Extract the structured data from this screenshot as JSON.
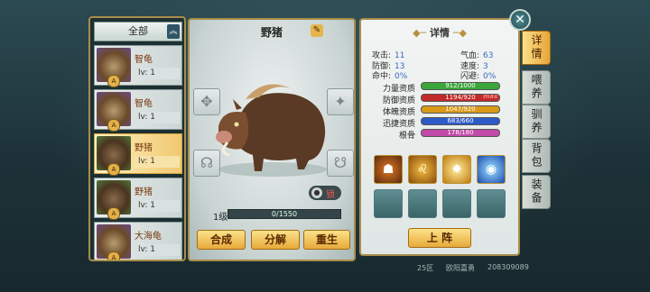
{
  "filter": {
    "label": "全部",
    "arrow": "︽"
  },
  "pets": [
    {
      "name": "智龟",
      "level": "lv: 1",
      "badge": "A",
      "selected": false
    },
    {
      "name": "智龟",
      "level": "lv: 1",
      "badge": "A",
      "selected": false
    },
    {
      "name": "野猪",
      "level": "lv: 1",
      "badge": "A",
      "selected": true
    },
    {
      "name": "野猪",
      "level": "lv: 1",
      "badge": "A",
      "selected": false
    },
    {
      "name": "大海龟",
      "level": "lv: 1",
      "badge": "A",
      "selected": false
    }
  ],
  "pet": {
    "name": "野猪",
    "edit_icon": "✎",
    "lock": {
      "icon": "锁",
      "label": "锁"
    },
    "level_label": "1级",
    "exp_text": "0/1550",
    "exp_fraction": 0.0
  },
  "actions": {
    "combine": "合成",
    "decompose": "分解",
    "reborn": "重生",
    "deploy": "上 阵"
  },
  "detail": {
    "header": "详情",
    "stats": [
      {
        "label": "攻击:",
        "value": "11"
      },
      {
        "label": "气血:",
        "value": "63"
      },
      {
        "label": "防御:",
        "value": "13"
      },
      {
        "label": "速度:",
        "value": "3"
      },
      {
        "label": "命中:",
        "value": "0%"
      },
      {
        "label": "闪避:",
        "value": "0%"
      }
    ],
    "aptitudes": [
      {
        "label": "力量资质",
        "text": "912/1000",
        "fraction": 0.912,
        "color": "#3aa63a"
      },
      {
        "label": "防御资质",
        "text": "1194/920",
        "fraction": 1.0,
        "color": "#c22a2a",
        "max": "max"
      },
      {
        "label": "体魄资质",
        "text": "1047/920",
        "fraction": 1.0,
        "color": "#d99a1a"
      },
      {
        "label": "迅捷资质",
        "text": "683/660",
        "fraction": 1.0,
        "color": "#2c5ac9"
      },
      {
        "label": "根骨",
        "text": "178/180",
        "fraction": 0.989,
        "color": "#c24aa8"
      }
    ],
    "skills": [
      {
        "icon": "beast-fury-icon",
        "color": "#8a3a10"
      },
      {
        "icon": "golden-lion-icon",
        "color": "#c07a10"
      },
      {
        "icon": "light-burst-icon",
        "color": "#d39a20"
      },
      {
        "icon": "blue-orb-icon",
        "color": "#2a6ad0"
      }
    ]
  },
  "tabs": [
    {
      "label": "详情",
      "active": true
    },
    {
      "label": "喂养",
      "active": false
    },
    {
      "label": "驯养",
      "active": false
    },
    {
      "label": "背包",
      "active": false
    },
    {
      "label": "装备",
      "active": false
    }
  ],
  "close": "✕",
  "footer": {
    "server": "25区",
    "player": "欧阳嘉勇",
    "id": "208309089"
  }
}
